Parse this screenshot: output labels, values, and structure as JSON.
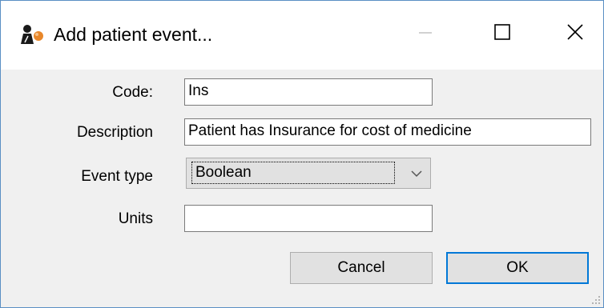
{
  "window": {
    "title": "Add patient event...",
    "icons": {
      "app": "app-logo-icon",
      "minimize": "minimize-icon",
      "maximize": "maximize-icon",
      "close": "close-icon"
    }
  },
  "form": {
    "code_label": "Code:",
    "code_value": "Ins",
    "description_label": "Description",
    "description_value": "Patient has Insurance for cost of medicine",
    "event_type_label": "Event type",
    "event_type_value": "Boolean",
    "units_label": "Units",
    "units_value": ""
  },
  "buttons": {
    "cancel": "Cancel",
    "ok": "OK"
  },
  "colors": {
    "accent": "#0078d7",
    "border": "#5a8fc4",
    "dialog_bg": "#f0f0f0"
  }
}
